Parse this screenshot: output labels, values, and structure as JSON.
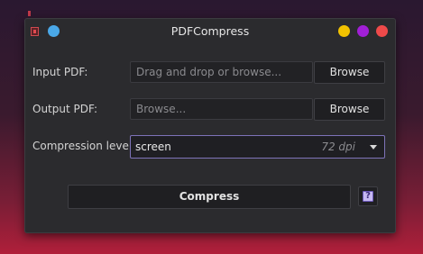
{
  "window": {
    "title": "PDFCompress"
  },
  "input_pdf": {
    "label": "Input PDF:",
    "placeholder": "Drag and drop or browse...",
    "browse_label": "Browse"
  },
  "output_pdf": {
    "label": "Output PDF:",
    "placeholder": "Browse...",
    "browse_label": "Browse"
  },
  "compression": {
    "label": "Compression level:",
    "selected": "screen",
    "selected_hint": "72 dpi"
  },
  "actions": {
    "compress_label": "Compress",
    "help_icon_text": "?"
  },
  "colors": {
    "accent_border": "#7e73b8",
    "dot_blue": "#4aa8e8",
    "dot_yellow": "#f2c200",
    "dot_purple": "#a11fd6",
    "dot_red": "#ef4a4a"
  },
  "icons": {
    "app": "pdf-app-icon",
    "help": "help-icon",
    "dropdown": "chevron-down-icon"
  }
}
